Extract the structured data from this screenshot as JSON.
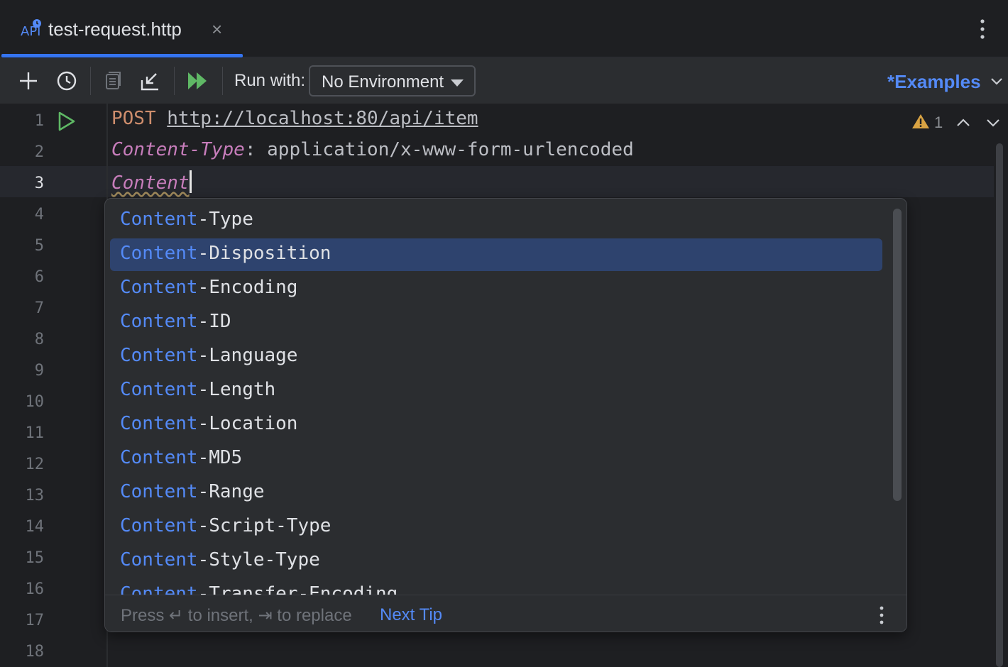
{
  "tab": {
    "title": "test-request.http",
    "close_glyph": "×",
    "icon": "api-file-icon"
  },
  "toolbar": {
    "run_with_label": "Run with:",
    "environment": "No Environment",
    "examples_label": "*Examples",
    "icons": [
      "plus-icon",
      "history-icon",
      "copy-icon",
      "import-icon",
      "run-all-icon"
    ]
  },
  "editor": {
    "line_numbers": [
      "1",
      "2",
      "3",
      "4",
      "5",
      "6",
      "7",
      "8",
      "9",
      "10",
      "11",
      "12",
      "13",
      "14",
      "15",
      "16",
      "17",
      "18"
    ],
    "current_line": 3,
    "line1": {
      "method": "POST",
      "url": "http://localhost:80/api/item"
    },
    "line2": {
      "header_name": "Content-Type",
      "colon": ":",
      "header_value": "application/x-www-form-urlencoded"
    },
    "line3": {
      "typed": "Content"
    },
    "warning_count": "1"
  },
  "completion": {
    "match_prefix": "Content",
    "items": [
      {
        "match": "Content",
        "rest": "-Type"
      },
      {
        "match": "Content",
        "rest": "-Disposition"
      },
      {
        "match": "Content",
        "rest": "-Encoding"
      },
      {
        "match": "Content",
        "rest": "-ID"
      },
      {
        "match": "Content",
        "rest": "-Language"
      },
      {
        "match": "Content",
        "rest": "-Length"
      },
      {
        "match": "Content",
        "rest": "-Location"
      },
      {
        "match": "Content",
        "rest": "-MD5"
      },
      {
        "match": "Content",
        "rest": "-Range"
      },
      {
        "match": "Content",
        "rest": "-Script-Type"
      },
      {
        "match": "Content",
        "rest": "-Style-Type"
      },
      {
        "match": "Content",
        "rest": "-Transfer-Encoding"
      }
    ],
    "selected_index": 1,
    "footer_hint": "Press ↵ to insert, ⇥ to replace",
    "footer_link": "Next Tip"
  },
  "colors": {
    "accent": "#3574f0",
    "link": "#548af7",
    "selection": "#2e436e",
    "run_green": "#5fb865",
    "warning": "#d9a343"
  }
}
